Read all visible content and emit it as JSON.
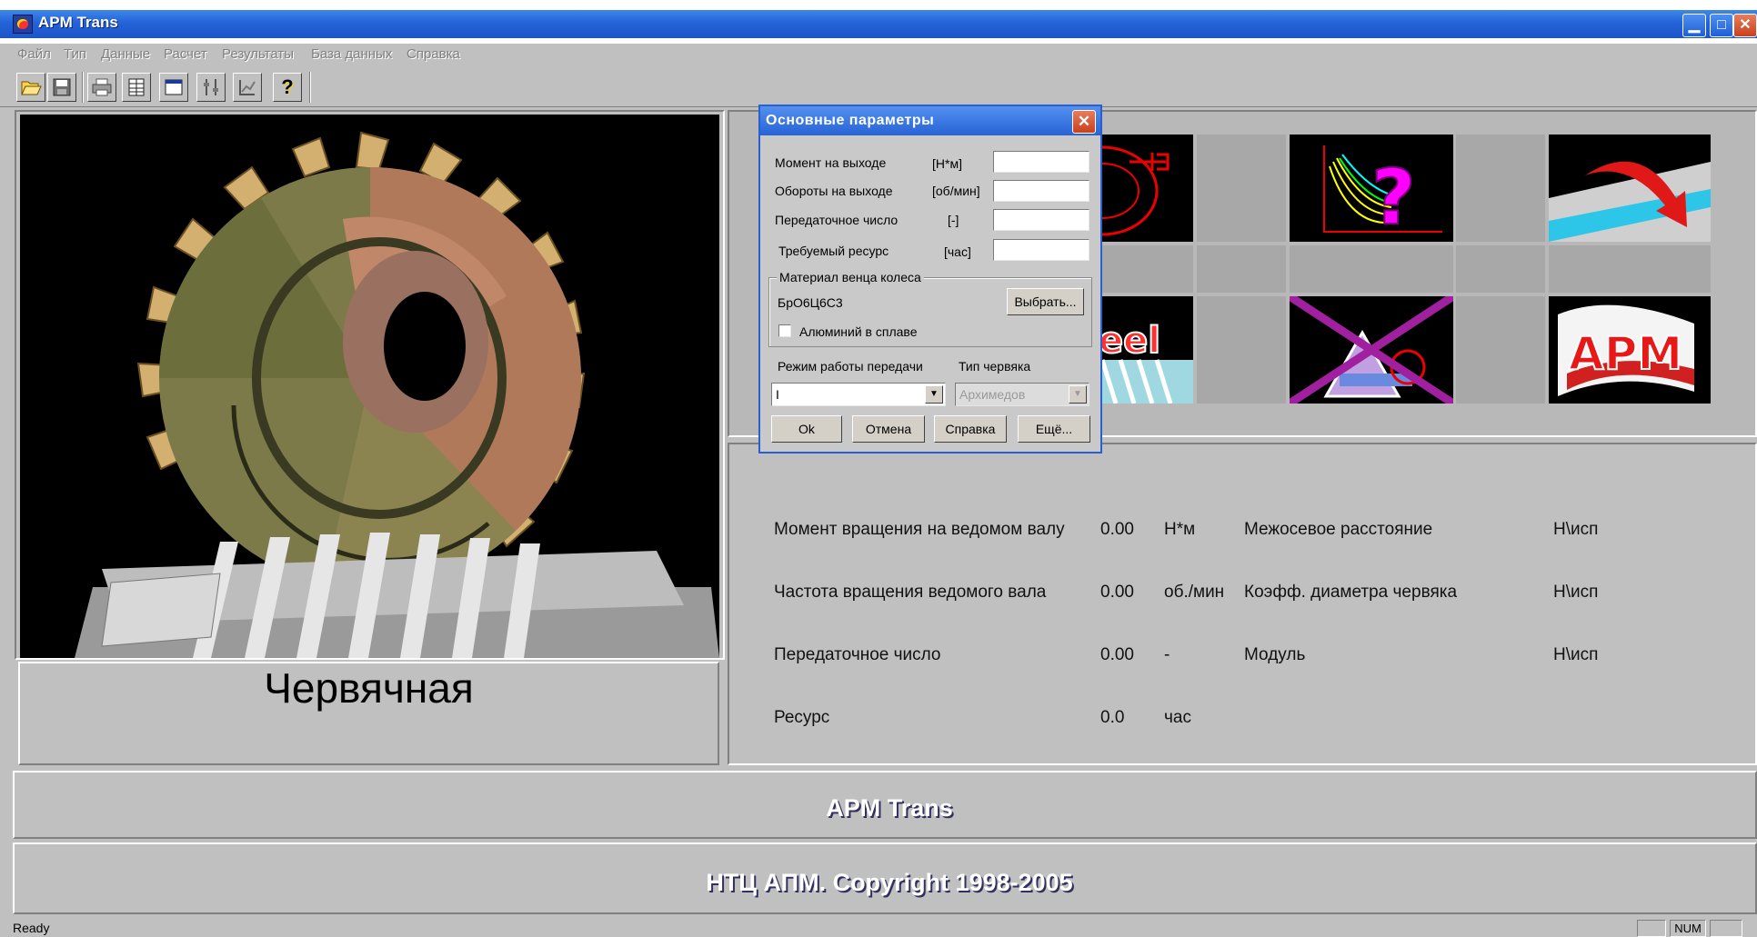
{
  "window": {
    "title": "APM Trans",
    "minimize": "▁",
    "maximize": "□",
    "close": "✕"
  },
  "menu": [
    "Файл",
    "Тип",
    "Данные",
    "Расчет",
    "Результаты",
    "База данных",
    "Справка"
  ],
  "toolbar": {
    "buttons": [
      {
        "name": "open-icon",
        "glyph": "📂"
      },
      {
        "name": "save-icon",
        "glyph": "▣"
      },
      {
        "name": "print-icon",
        "glyph": "⎙"
      },
      {
        "name": "data-table-icon",
        "glyph": "▦"
      },
      {
        "name": "window-icon",
        "glyph": "▭"
      },
      {
        "name": "sliders-icon",
        "glyph": "⇅"
      },
      {
        "name": "chart-icon",
        "glyph": "⧄"
      },
      {
        "name": "help-icon",
        "glyph": "?"
      }
    ]
  },
  "preview": {
    "caption": "Червячная"
  },
  "results": {
    "left": [
      {
        "label": "Момент вращения на ведомом валу",
        "value": "0.00",
        "unit": "Н*м"
      },
      {
        "label": "Частота вращения ведомого вала",
        "value": "0.00",
        "unit": "об./мин"
      },
      {
        "label": "Передаточное число",
        "value": "0.00",
        "unit": "-"
      },
      {
        "label": "Ресурс",
        "value": "0.0",
        "unit": "час"
      }
    ],
    "right": [
      {
        "label": "Межосевое расстояние",
        "value": "Н\\исп"
      },
      {
        "label": "Коэфф. диаметра червяка",
        "value": "Н\\исп"
      },
      {
        "label": "Модуль",
        "value": "Н\\исп"
      }
    ]
  },
  "footer": {
    "line1": "APM Trans",
    "line2": "НТЦ АПМ. Copyright 1998-2005"
  },
  "statusbar": {
    "text": "Ready",
    "num": "NUM"
  },
  "dialog": {
    "title": "Основные параметры",
    "close": "✕",
    "fields": [
      {
        "label": "Момент на выходе",
        "unit": "[Н*м]",
        "value": ""
      },
      {
        "label": "Обороты на выходе",
        "unit": "[об/мин]",
        "value": ""
      },
      {
        "label": "Передаточное число",
        "unit": "[-]",
        "value": ""
      },
      {
        "label": "Требуемый ресурс",
        "unit": "[час]",
        "value": ""
      }
    ],
    "material_group": "Материал венца колеса",
    "material_value": "БрО6Ц6С3",
    "choose_button": "Выбрать...",
    "aluminum_checkbox": "Алюминий в сплаве",
    "aluminum_checked": false,
    "mode_label": "Режим работы передачи",
    "mode_value": "I",
    "worm_type_label": "Тип червяка",
    "worm_type_value": "Архимедов",
    "buttons": [
      "Ok",
      "Отмена",
      "Справка",
      "Ещё..."
    ]
  },
  "thumbnails": {
    "apm_logo_text": "APM",
    "graph_question": "?",
    "steel_text": "eel"
  }
}
